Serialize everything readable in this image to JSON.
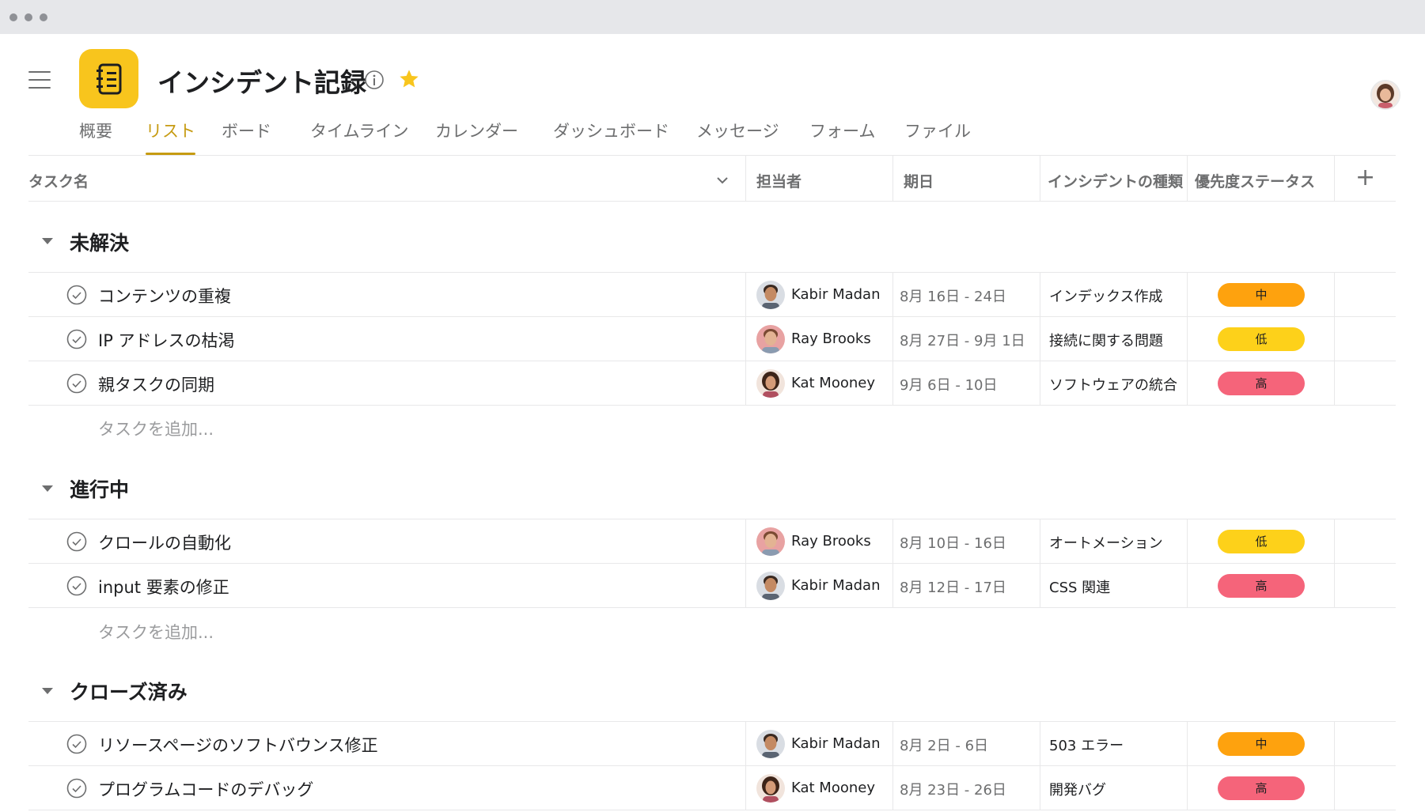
{
  "project": {
    "title": "インシデント記録"
  },
  "tabs": [
    {
      "label": "概要"
    },
    {
      "label": "リスト"
    },
    {
      "label": "ボード"
    },
    {
      "label": "タイムライン"
    },
    {
      "label": "カレンダー"
    },
    {
      "label": "ダッシュボード"
    },
    {
      "label": "メッセージ"
    },
    {
      "label": "フォーム"
    },
    {
      "label": "ファイル"
    }
  ],
  "active_tab": "リスト",
  "columns": {
    "task_name": "タスク名",
    "assignee": "担当者",
    "due_date": "期日",
    "incident_type": "インシデントの種類",
    "priority": "優先度ステータス"
  },
  "add_task_label": "タスクを追加...",
  "priority_colors": {
    "中": "#fea20e",
    "低": "#fdd11a",
    "高": "#f5647a"
  },
  "accent_color": "#c69b12",
  "sections": [
    {
      "title": "未解決",
      "tasks": [
        {
          "name": "コンテンツの重複",
          "assignee": "Kabir Madan",
          "dates": "8月 16日 - 24日",
          "type": "インデックス作成",
          "priority": "中"
        },
        {
          "name": "IP アドレスの枯渇",
          "assignee": "Ray Brooks",
          "dates": "8月 27日 - 9月 1日",
          "type": "接続に関する問題",
          "priority": "低"
        },
        {
          "name": "親タスクの同期",
          "assignee": "Kat Mooney",
          "dates": "9月 6日 - 10日",
          "type": "ソフトウェアの統合",
          "priority": "高"
        }
      ]
    },
    {
      "title": "進行中",
      "tasks": [
        {
          "name": "クロールの自動化",
          "assignee": "Ray Brooks",
          "dates": "8月 10日 - 16日",
          "type": "オートメーション",
          "priority": "低"
        },
        {
          "name": "input 要素の修正",
          "assignee": "Kabir Madan",
          "dates": "8月 12日 - 17日",
          "type": "CSS 関連",
          "priority": "高"
        }
      ]
    },
    {
      "title": "クローズ済み",
      "tasks": [
        {
          "name": "リソースページのソフトバウンス修正",
          "assignee": "Kabir Madan",
          "dates": "8月 2日 - 6日",
          "type": "503 エラー",
          "priority": "中"
        },
        {
          "name": "プログラムコードのデバッグ",
          "assignee": "Kat Mooney",
          "dates": "8月 23日 - 26日",
          "type": "開発バグ",
          "priority": "高"
        }
      ]
    }
  ]
}
